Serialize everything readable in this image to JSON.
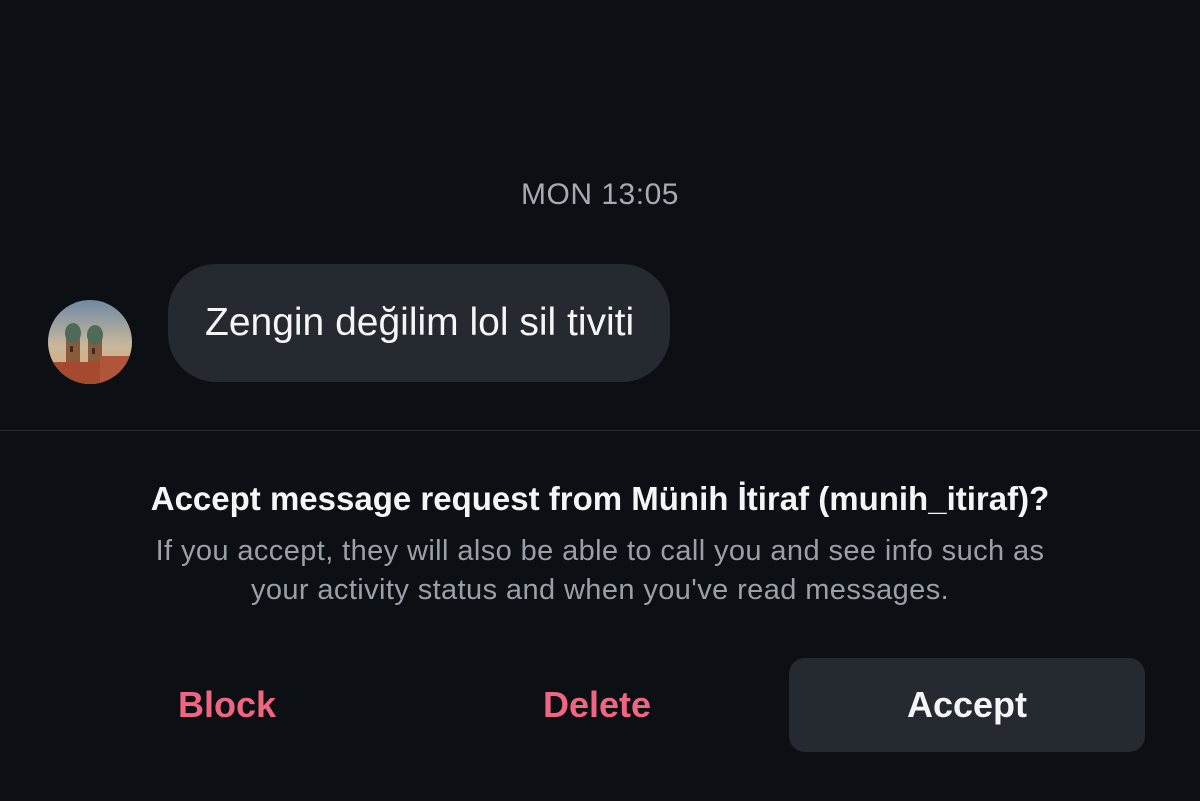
{
  "conversation": {
    "timestamp": "MON 13:05",
    "message": {
      "text": "Zengin değilim lol sil tiviti",
      "avatar_icon": "cathedral-avatar"
    }
  },
  "request": {
    "title": "Accept message request from Münih İtiraf (munih_itiraf)?",
    "description_lines": [
      "If you accept, they will also be able to call you and see info such as",
      "your activity status and when you've read messages."
    ]
  },
  "actions": {
    "block_label": "Block",
    "delete_label": "Delete",
    "accept_label": "Accept"
  },
  "colors": {
    "background": "#0c0f14",
    "bubble": "#252a31",
    "danger": "#f06680",
    "muted_text": "#9aa0a8"
  }
}
